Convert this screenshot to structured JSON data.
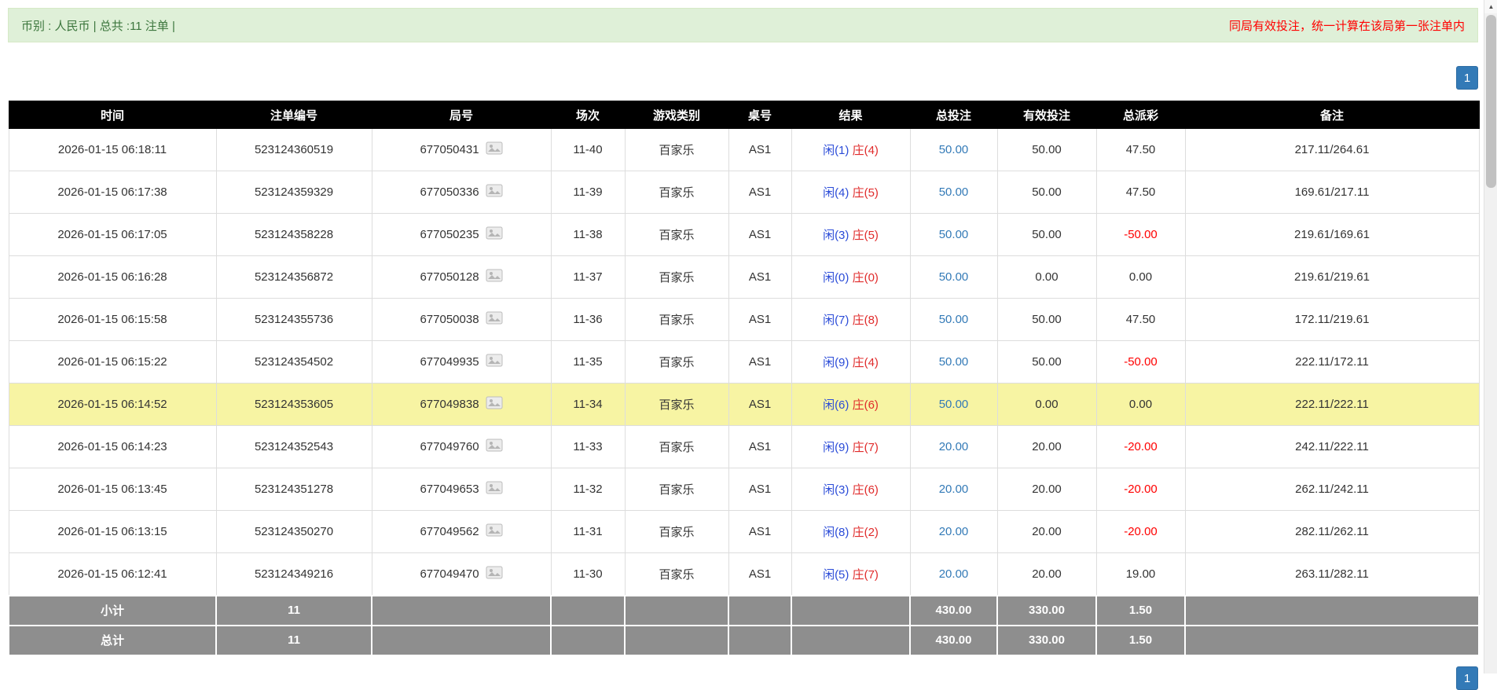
{
  "topbar": {
    "summary": "币别 : 人民币 | 总共 :11 注单 |",
    "notice": "同局有效投注，统一计算在该局第一张注单内"
  },
  "pagination": {
    "page": "1"
  },
  "table": {
    "columns": [
      "时间",
      "注单编号",
      "局号",
      "场次",
      "游戏类别",
      "桌号",
      "结果",
      "总投注",
      "有效投注",
      "总派彩",
      "备注"
    ],
    "rows": [
      {
        "time": "2026-01-15 06:18:11",
        "bet_id": "523124360519",
        "round": "677050431",
        "session": "11-40",
        "game": "百家乐",
        "table": "AS1",
        "result_player": "闲(1)",
        "result_banker": "庄(4)",
        "total_bet": "50.00",
        "valid_bet": "50.00",
        "payout": "47.50",
        "remark": "217.11/264.61",
        "highlight": false
      },
      {
        "time": "2026-01-15 06:17:38",
        "bet_id": "523124359329",
        "round": "677050336",
        "session": "11-39",
        "game": "百家乐",
        "table": "AS1",
        "result_player": "闲(4)",
        "result_banker": "庄(5)",
        "total_bet": "50.00",
        "valid_bet": "50.00",
        "payout": "47.50",
        "remark": "169.61/217.11",
        "highlight": false
      },
      {
        "time": "2026-01-15 06:17:05",
        "bet_id": "523124358228",
        "round": "677050235",
        "session": "11-38",
        "game": "百家乐",
        "table": "AS1",
        "result_player": "闲(3)",
        "result_banker": "庄(5)",
        "total_bet": "50.00",
        "valid_bet": "50.00",
        "payout": "-50.00",
        "remark": "219.61/169.61",
        "highlight": false
      },
      {
        "time": "2026-01-15 06:16:28",
        "bet_id": "523124356872",
        "round": "677050128",
        "session": "11-37",
        "game": "百家乐",
        "table": "AS1",
        "result_player": "闲(0)",
        "result_banker": "庄(0)",
        "total_bet": "50.00",
        "valid_bet": "0.00",
        "payout": "0.00",
        "remark": "219.61/219.61",
        "highlight": false
      },
      {
        "time": "2026-01-15 06:15:58",
        "bet_id": "523124355736",
        "round": "677050038",
        "session": "11-36",
        "game": "百家乐",
        "table": "AS1",
        "result_player": "闲(7)",
        "result_banker": "庄(8)",
        "total_bet": "50.00",
        "valid_bet": "50.00",
        "payout": "47.50",
        "remark": "172.11/219.61",
        "highlight": false
      },
      {
        "time": "2026-01-15 06:15:22",
        "bet_id": "523124354502",
        "round": "677049935",
        "session": "11-35",
        "game": "百家乐",
        "table": "AS1",
        "result_player": "闲(9)",
        "result_banker": "庄(4)",
        "total_bet": "50.00",
        "valid_bet": "50.00",
        "payout": "-50.00",
        "remark": "222.11/172.11",
        "highlight": false
      },
      {
        "time": "2026-01-15 06:14:52",
        "bet_id": "523124353605",
        "round": "677049838",
        "session": "11-34",
        "game": "百家乐",
        "table": "AS1",
        "result_player": "闲(6)",
        "result_banker": "庄(6)",
        "total_bet": "50.00",
        "valid_bet": "0.00",
        "payout": "0.00",
        "remark": "222.11/222.11",
        "highlight": true
      },
      {
        "time": "2026-01-15 06:14:23",
        "bet_id": "523124352543",
        "round": "677049760",
        "session": "11-33",
        "game": "百家乐",
        "table": "AS1",
        "result_player": "闲(9)",
        "result_banker": "庄(7)",
        "total_bet": "20.00",
        "valid_bet": "20.00",
        "payout": "-20.00",
        "remark": "242.11/222.11",
        "highlight": false
      },
      {
        "time": "2026-01-15 06:13:45",
        "bet_id": "523124351278",
        "round": "677049653",
        "session": "11-32",
        "game": "百家乐",
        "table": "AS1",
        "result_player": "闲(3)",
        "result_banker": "庄(6)",
        "total_bet": "20.00",
        "valid_bet": "20.00",
        "payout": "-20.00",
        "remark": "262.11/242.11",
        "highlight": false
      },
      {
        "time": "2026-01-15 06:13:15",
        "bet_id": "523124350270",
        "round": "677049562",
        "session": "11-31",
        "game": "百家乐",
        "table": "AS1",
        "result_player": "闲(8)",
        "result_banker": "庄(2)",
        "total_bet": "20.00",
        "valid_bet": "20.00",
        "payout": "-20.00",
        "remark": "282.11/262.11",
        "highlight": false
      },
      {
        "time": "2026-01-15 06:12:41",
        "bet_id": "523124349216",
        "round": "677049470",
        "session": "11-30",
        "game": "百家乐",
        "table": "AS1",
        "result_player": "闲(5)",
        "result_banker": "庄(7)",
        "total_bet": "20.00",
        "valid_bet": "20.00",
        "payout": "19.00",
        "remark": "263.11/282.11",
        "highlight": false
      }
    ],
    "footer": [
      {
        "label": "小计",
        "count": "11",
        "total_bet": "430.00",
        "valid_bet": "330.00",
        "payout": "1.50"
      },
      {
        "label": "总计",
        "count": "11",
        "total_bet": "430.00",
        "valid_bet": "330.00",
        "payout": "1.50"
      }
    ]
  },
  "icons": {
    "round_result_icon": "round-result-image-icon",
    "scrollbar_up_arrow": "▲"
  },
  "colors": {
    "topbar_bg": "#dff0d8",
    "topbar_text": "#3c763d",
    "notice_red": "#ff0000",
    "accent_blue": "#337ab7",
    "header_bg": "#000000",
    "footer_bg": "#8e8e8e",
    "highlight_yellow": "#f7f4a3",
    "link_blue": "#337ab7",
    "player_blue": "#2b4cd8",
    "banker_red": "#e02b2b",
    "negative_red": "#ff0000"
  }
}
